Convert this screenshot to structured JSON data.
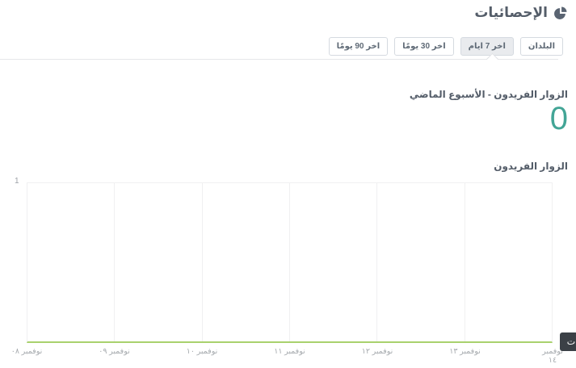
{
  "header": {
    "title": "الإحصائيات",
    "icon": "pie-chart-icon"
  },
  "toolbar": {
    "buttons": [
      {
        "label": "البلدان",
        "active": false
      },
      {
        "label": "اخر 7 ايام",
        "active": true
      },
      {
        "label": "اخر 30 يومًا",
        "active": false
      },
      {
        "label": "اخر 90 يومًا",
        "active": false
      }
    ]
  },
  "summary": {
    "title": "الزوار الفريدون - الأسبوع الماضي",
    "value": "0"
  },
  "chart_data": {
    "type": "line",
    "title": "الزوار الفريدون",
    "categories": [
      "نوفمبر ٠٨",
      "نوفمبر ٠٩",
      "نوفمبر ١٠",
      "نوفمبر ١١",
      "نوفمبر ١٢",
      "نوفمبر ١٣",
      "نوفمبر ١٤"
    ],
    "values": [
      0,
      0,
      0,
      0,
      0,
      0,
      0
    ],
    "xlabel": "",
    "ylabel": "",
    "ylim": [
      0,
      1
    ],
    "yticks": [
      "1"
    ],
    "grid": "vertical-only",
    "legend": "none",
    "line_color": "#a9d16d"
  },
  "tooltip": {
    "visible_text": "دات"
  },
  "colors": {
    "accent_teal": "#43a596",
    "line_green": "#a9d16d",
    "text_dark": "#545d69",
    "text_muted": "#9da1a7",
    "button_border": "#d5dae0",
    "button_active_bg": "#e9ebee",
    "tooltip_bg": "#3b4046",
    "gridline": "#f0f0f1"
  }
}
